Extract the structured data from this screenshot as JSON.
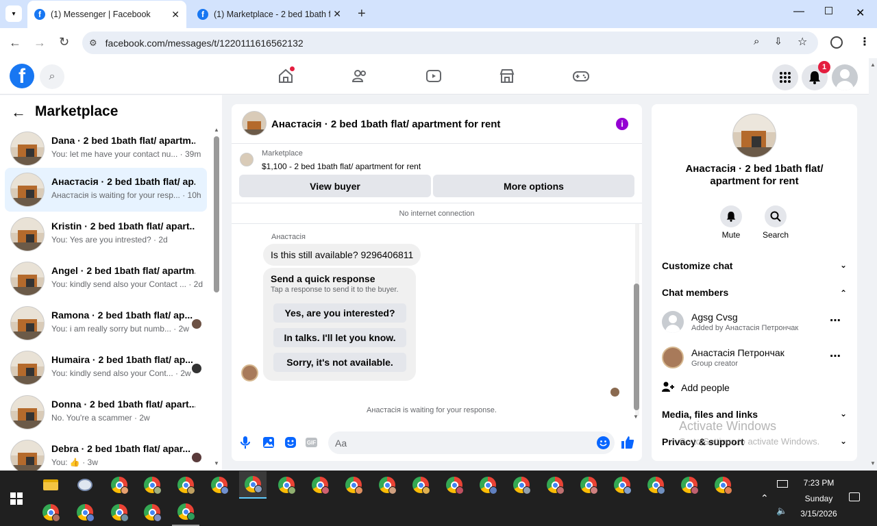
{
  "browser": {
    "tabs": [
      {
        "title": "(1) Messenger | Facebook",
        "active": true
      },
      {
        "title": "(1) Marketplace - 2 bed 1bath f",
        "active": false
      }
    ],
    "url": "facebook.com/messages/t/1220111616562132"
  },
  "header": {
    "notification_count": "1"
  },
  "sidebar": {
    "title": "Marketplace",
    "conversations": [
      {
        "name": "Dana · 2 bed 1bath flat/ apartm...",
        "preview": "You: let me have your contact nu... · 39m",
        "selected": false
      },
      {
        "name": "Анастасія · 2 bed 1bath flat/ ap...",
        "preview": "Анастасія is waiting for your resp... · 10h",
        "selected": true
      },
      {
        "name": "Kristin · 2 bed 1bath flat/ apart...",
        "preview": "You: Yes are you intrested? · 2d",
        "selected": false
      },
      {
        "name": "Angel · 2 bed 1bath flat/ apartm...",
        "preview": "You: kindly send also your Contact ... · 2d",
        "selected": false
      },
      {
        "name": "Ramona · 2 bed 1bath flat/ ap...",
        "preview": "You: i am really sorry but numb... · 2w",
        "selected": false
      },
      {
        "name": "Humaira · 2 bed 1bath flat/ ap...",
        "preview": "You: kindly send also your Cont... · 2w",
        "selected": false
      },
      {
        "name": "Donna · 2 bed 1bath flat/ apart...",
        "preview": "No. You're a scammer · 2w",
        "selected": false
      },
      {
        "name": "Debra · 2 bed 1bath flat/ apar...",
        "preview": "You: 👍 · 3w",
        "selected": false
      }
    ]
  },
  "chat": {
    "title": "Анастасія · 2 bed 1bath flat/ apartment for rent",
    "listing_label": "Marketplace",
    "listing_text": "$1,100 - 2 bed 1bath flat/ apartment for rent",
    "view_buyer": "View buyer",
    "more_options": "More options",
    "connection_status": "No internet connection",
    "sender_name": "Анастасія",
    "message": "Is this still available? 9296406811",
    "quick_title": "Send a quick response",
    "quick_subtitle": "Tap a response to send it to the buyer.",
    "quick_responses": [
      "Yes, are you interested?",
      "In talks. I'll let you know.",
      "Sorry, it's not available."
    ],
    "waiting_text": "Анастасія is waiting for your response.",
    "composer_placeholder": "Aa"
  },
  "details": {
    "title": "Анастасія · 2 bed 1bath flat/ apartment for rent",
    "mute_label": "Mute",
    "search_label": "Search",
    "customize_chat": "Customize chat",
    "chat_members": "Chat members",
    "members": [
      {
        "name": "Agsg Cvsg",
        "sub": "Added by Анастасія Петрончак"
      },
      {
        "name": "Анастасія Петрончак",
        "sub": "Group creator"
      }
    ],
    "add_people": "Add people",
    "media_files_links": "Media, files and links",
    "privacy_support": "Privacy & support"
  },
  "watermark": {
    "line1": "Activate Windows",
    "line2": "Go to Settings to activate Windows."
  },
  "taskbar": {
    "time": "7:23 PM",
    "day": "Sunday",
    "date": "3/15/2026"
  }
}
